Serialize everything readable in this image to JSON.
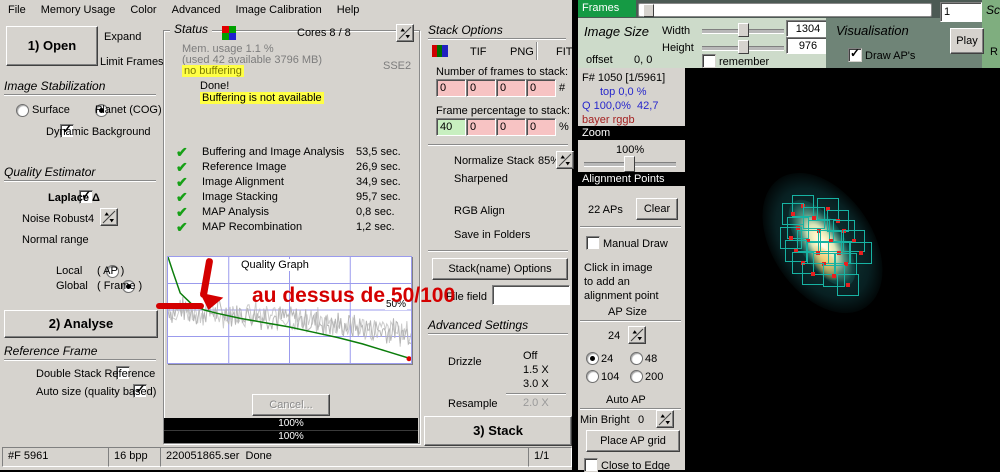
{
  "menu": {
    "items": [
      {
        "label": "File"
      },
      {
        "label": "Memory Usage"
      },
      {
        "label": "Color"
      },
      {
        "label": "Advanced"
      },
      {
        "label": "Image Calibration"
      },
      {
        "label": "Help"
      }
    ]
  },
  "left": {
    "open_button": "1) Open",
    "expand": "Expand",
    "limit_frames": "Limit Frames",
    "stabilization": {
      "title": "Image Stabilization",
      "surface": "Surface",
      "planet": "Planet (COG)",
      "dynamic_background": "Dynamic Background"
    },
    "quality": {
      "title": "Quality Estimator",
      "laplace": "Laplace Δ",
      "noise_robust": "Noise Robust",
      "noise_value": "4",
      "range": "Normal range",
      "local": "Local",
      "local_suffix": "( AP )",
      "global": "Global",
      "global_suffix": "( Frame )"
    },
    "analyse_button": "2) Analyse",
    "reference": {
      "title": "Reference Frame",
      "double_stack": "Double Stack Reference",
      "auto_size": "Auto size (quality based)"
    }
  },
  "status": {
    "title": "Status",
    "cores": "Cores 8 / 8",
    "sse": "SSE2",
    "mem_line1": "Mem. usage 1.1 %",
    "mem_line2": "(used 42 available 3796 MB)",
    "no_buffering": "no buffering",
    "done": "Done!",
    "buffering_na": "Buffering is not available",
    "tasks": [
      {
        "label": "Buffering and Image Analysis",
        "time": "53,5 sec."
      },
      {
        "label": "Reference Image",
        "time": "26,9 sec."
      },
      {
        "label": "Image Alignment",
        "time": "34,9 sec."
      },
      {
        "label": "Image Stacking",
        "time": "95,7 sec."
      },
      {
        "label": "MAP Analysis",
        "time": "0,8 sec."
      },
      {
        "label": "MAP Recombination",
        "time": "1,2 sec."
      }
    ],
    "cancel_button": "Cancel...",
    "progress": [
      "100%",
      "100%"
    ]
  },
  "annotation": {
    "text": "au dessus de 50/100",
    "color": "#d40000"
  },
  "quality_graph": {
    "type": "line",
    "title": "Quality Graph",
    "y_label_50": "50%",
    "x_range": [
      1,
      5961
    ],
    "y_range": [
      0,
      100
    ],
    "curve_percent": [
      [
        0,
        100
      ],
      [
        0.02,
        86
      ],
      [
        0.05,
        66
      ],
      [
        0.1,
        55
      ],
      [
        0.15,
        50
      ],
      [
        0.2,
        47
      ],
      [
        0.3,
        42
      ],
      [
        0.4,
        38
      ],
      [
        0.5,
        34
      ],
      [
        0.6,
        29
      ],
      [
        0.7,
        24
      ],
      [
        0.8,
        18
      ],
      [
        0.9,
        11
      ],
      [
        1,
        4
      ]
    ],
    "noise_base": [
      [
        0,
        50
      ],
      [
        0.2,
        48
      ],
      [
        0.5,
        42
      ],
      [
        0.8,
        33
      ],
      [
        1,
        27
      ]
    ],
    "noise_amp": 15,
    "noise_seed": 7,
    "curve_color": "#0b7d0b",
    "noise_color": "#b6b6b6",
    "grid_color": "#9b9bed",
    "end_dot_color": "#dd0000"
  },
  "stack": {
    "title": "Stack Options",
    "formats": [
      "TIF",
      "PNG",
      "FIT"
    ],
    "frames_label": "Number of frames to stack:",
    "frames_values": [
      "0",
      "0",
      "0",
      "0"
    ],
    "frames_unit": "#",
    "percent_label": "Frame percentage to stack:",
    "percent_values": [
      "40",
      "0",
      "0",
      "0"
    ],
    "percent_unit": "%",
    "normalize": "Normalize Stack",
    "normalize_value": "85%",
    "sharpened": "Sharpened",
    "rgb_align": "RGB Align",
    "save_folders": "Save in Folders",
    "stackname_button": "Stack(name) Options",
    "file_field_label": "File field",
    "file_field_value": "",
    "advanced_title": "Advanced Settings",
    "drizzle_label": "Drizzle",
    "drizzle_options": [
      "Off",
      "1.5 X",
      "3.0 X"
    ],
    "resample_label": "Resample",
    "resample_option": "2.0 X",
    "stack_button": "3) Stack"
  },
  "statusbar": {
    "frames": "#F 5961",
    "depth": "16 bpp",
    "file": "220051865.ser",
    "state": "Done",
    "page": "1/1"
  },
  "right": {
    "frames_label": "Frames",
    "frame_number": "1",
    "partial_top": "Sc",
    "partial_bottom": "R",
    "image_size": {
      "title": "Image Size",
      "width_label": "Width",
      "width_value": "1304",
      "height_label": "Height",
      "height_value": "976",
      "offset_label": "offset",
      "offset_value": "0, 0",
      "remember": "remember"
    },
    "visualisation": {
      "title": "Visualisation",
      "draw_aps": "Draw AP's",
      "play": "Play"
    },
    "info": {
      "frame": "F# 1050 [1/5961]",
      "top": "top 0,0 %",
      "q": "Q 100,0%",
      "q2": "42,7",
      "bayer": "bayer rggb"
    },
    "zoom": {
      "header": "Zoom",
      "value": "100%"
    },
    "alignment": {
      "header": "Alignment Points",
      "count": "22 APs",
      "clear": "Clear",
      "manual_draw": "Manual Draw",
      "hint1": "Click in image",
      "hint2": "to add an",
      "hint3": "alignment point",
      "ap_size": "AP Size",
      "size_value": "24",
      "sizes": [
        "24",
        "48",
        "104",
        "200"
      ],
      "auto_ap": "Auto AP",
      "min_bright": "Min Bright",
      "min_bright_value": "0",
      "place_button": "Place AP grid",
      "close_edge": "Close to Edge"
    }
  },
  "ap_overlay": {
    "box_size": 20,
    "box_color": "#17b3a3",
    "dot_color": "#e82020",
    "boxes": [
      [
        107,
        127
      ],
      [
        132,
        130
      ],
      [
        97,
        135
      ],
      [
        118,
        139
      ],
      [
        142,
        142
      ],
      [
        102,
        149
      ],
      [
        123,
        152
      ],
      [
        148,
        152
      ],
      [
        95,
        159
      ],
      [
        112,
        162
      ],
      [
        135,
        162
      ],
      [
        158,
        162
      ],
      [
        100,
        172
      ],
      [
        122,
        174
      ],
      [
        143,
        174
      ],
      [
        165,
        174
      ],
      [
        107,
        184
      ],
      [
        128,
        185
      ],
      [
        150,
        185
      ],
      [
        117,
        195
      ],
      [
        138,
        197
      ],
      [
        152,
        206
      ]
    ]
  }
}
